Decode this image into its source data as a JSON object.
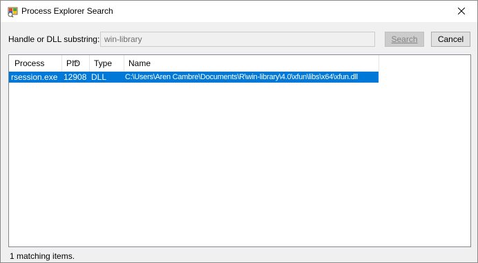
{
  "window": {
    "title": "Process Explorer Search",
    "app_icon": "process-explorer-icon",
    "close_icon": "close-icon"
  },
  "search": {
    "label": "Handle or DLL substring:",
    "value": "win-library",
    "search_button": "Search",
    "cancel_button": "Cancel"
  },
  "table": {
    "columns": [
      "Process",
      "PID",
      "Type",
      "Name"
    ],
    "sorted_column": "PID",
    "rows": [
      {
        "process": "rsession.exe",
        "pid": "12908",
        "type": "DLL",
        "name": "C:\\Users\\Aren Cambre\\Documents\\R\\win-library\\4.0\\xfun\\libs\\x64\\xfun.dll",
        "selected": true
      }
    ]
  },
  "status": {
    "text": "1 matching items."
  },
  "colors": {
    "selection": "#0078d7",
    "window_bg": "#f0f0f0"
  }
}
